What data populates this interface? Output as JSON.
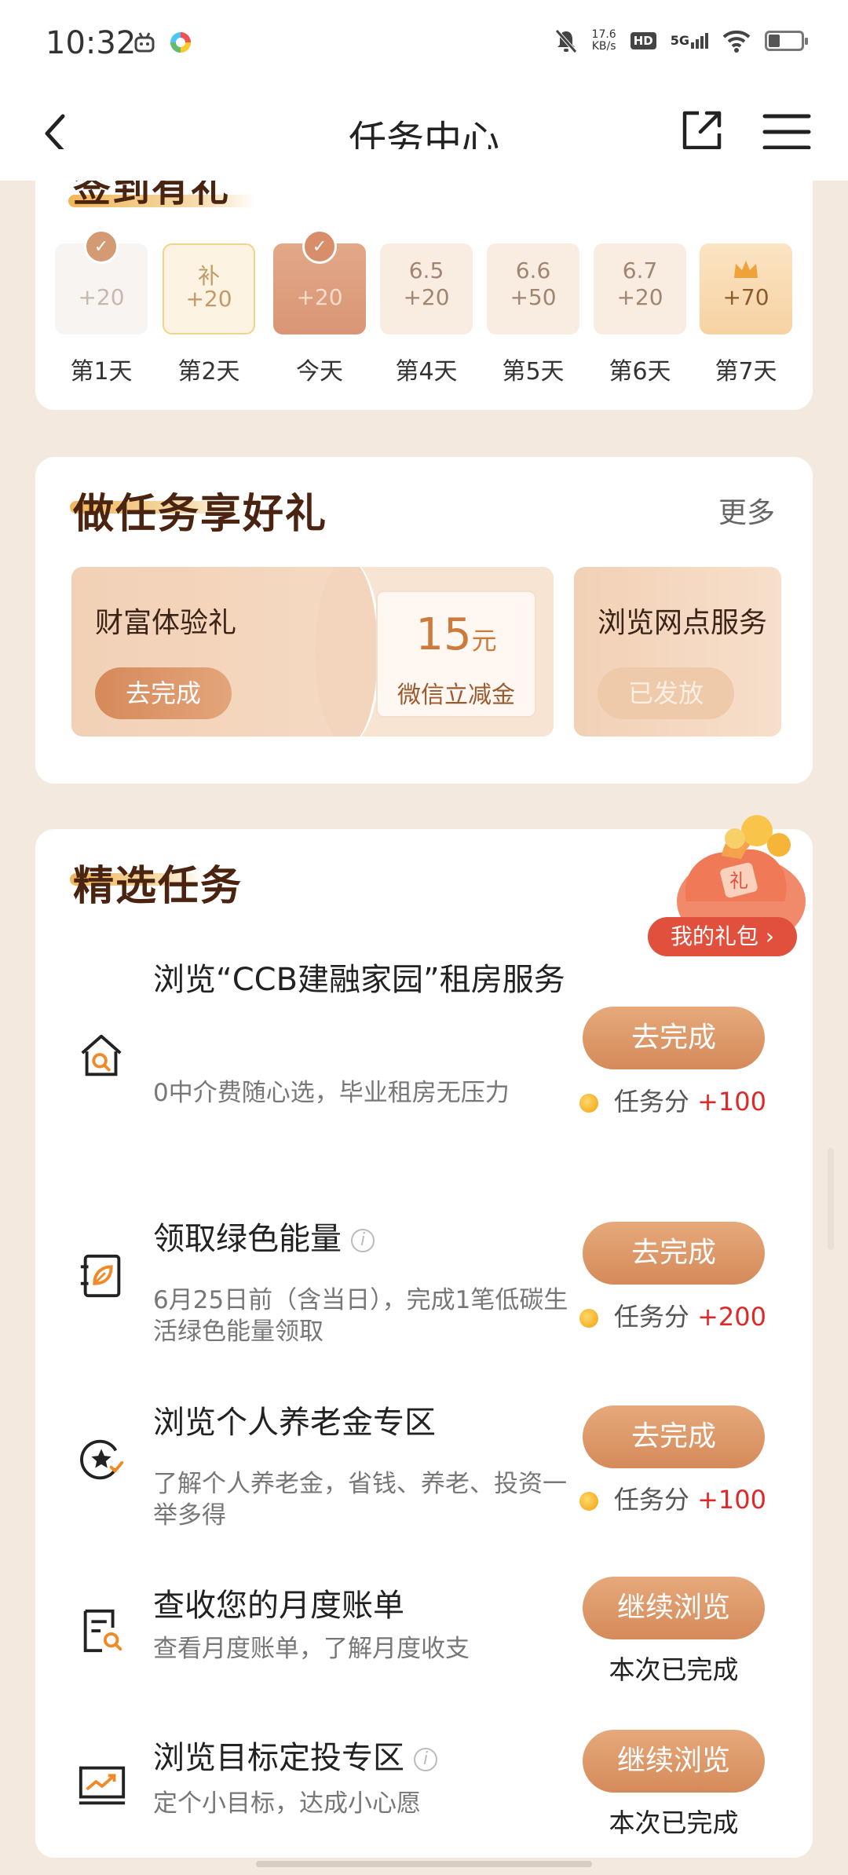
{
  "status_bar": {
    "time": "10:32",
    "net_speed_value": "17.6",
    "net_speed_unit": "KB/s",
    "hd_label": "HD",
    "signal_label": "5G",
    "battery_level": 0.35
  },
  "nav": {
    "title": "任务中心"
  },
  "sign_in": {
    "title": "签到有礼",
    "days": [
      {
        "top": "",
        "points": "+20",
        "label": "第1天",
        "state": "checked"
      },
      {
        "top": "补",
        "points": "+20",
        "label": "第2天",
        "state": "makeup"
      },
      {
        "top": "",
        "points": "+20",
        "label": "今天",
        "state": "today"
      },
      {
        "top": "6.5",
        "points": "+20",
        "label": "第4天",
        "state": "future"
      },
      {
        "top": "6.6",
        "points": "+50",
        "label": "第5天",
        "state": "future"
      },
      {
        "top": "6.7",
        "points": "+20",
        "label": "第6天",
        "state": "future"
      },
      {
        "top": "crown-icon",
        "points": "+70",
        "label": "第7天",
        "state": "bonus"
      }
    ]
  },
  "task_gifts": {
    "title": "做任务享好礼",
    "more_label": "更多",
    "rewards": [
      {
        "name": "财富体验礼",
        "button": "去完成",
        "coupon_amount": "15",
        "coupon_unit": "元",
        "coupon_desc": "微信立减金"
      },
      {
        "name": "浏览网点服务",
        "button": "已发放"
      }
    ]
  },
  "featured": {
    "title": "精选任务",
    "gift_bag_label": "我的礼包",
    "gift_bag_badge": "礼",
    "tasks": [
      {
        "title": "浏览“CCB建融家园”租房服务",
        "desc": "0中介费随心选，毕业租房无压力",
        "button": "去完成",
        "score_label": "任务分",
        "score_value": "+100",
        "icon": "house-search-icon"
      },
      {
        "title": "领取绿色能量",
        "desc": "6月25日前（含当日），完成1笔低碳生活绿色能量领取",
        "button": "去完成",
        "score_label": "任务分",
        "score_value": "+200",
        "icon": "leaf-energy-icon",
        "info": "i"
      },
      {
        "title": "浏览个人养老金专区",
        "desc": "了解个人养老金，省钱、养老、投资一举多得",
        "button": "去完成",
        "score_label": "任务分",
        "score_value": "+100",
        "icon": "star-badge-icon"
      },
      {
        "title": "查收您的月度账单",
        "desc": "查看月度账单，了解月度收支",
        "button": "继续浏览",
        "status": "本次已完成",
        "icon": "bill-search-icon"
      },
      {
        "title": "浏览目标定投专区",
        "desc": "定个小目标，达成小心愿",
        "button": "继续浏览",
        "status": "本次已完成",
        "icon": "trend-chart-icon",
        "info": "i"
      }
    ]
  },
  "colors": {
    "accent": "#d58a5a",
    "title_brown": "#4a2410",
    "score_red": "#e02828",
    "page_bg": "#f4e9df"
  }
}
